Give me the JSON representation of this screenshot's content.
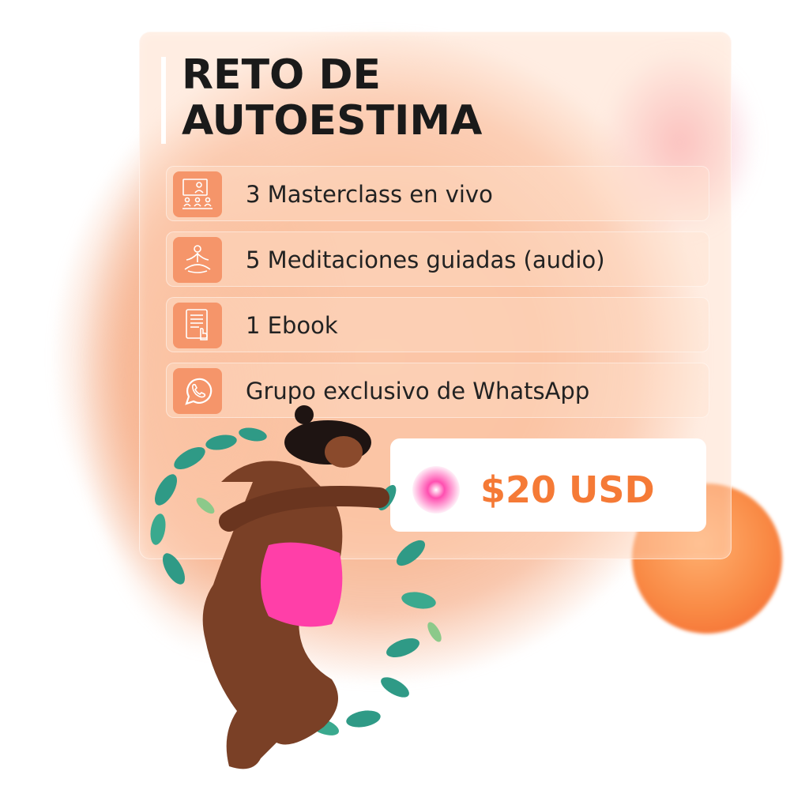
{
  "title": {
    "line1": "RETO DE",
    "line2": "AUTOESTIMA"
  },
  "features": [
    {
      "icon": "masterclass-presentation-icon",
      "label": "3 Masterclass en vivo"
    },
    {
      "icon": "meditation-icon",
      "label": "5 Meditaciones guiadas (audio)"
    },
    {
      "icon": "ebook-tablet-icon",
      "label": "1 Ebook"
    },
    {
      "icon": "whatsapp-icon",
      "label": "Grupo exclusivo de WhatsApp"
    }
  ],
  "price": "$20 USD",
  "colors": {
    "accent_orange": "#f57a36",
    "icon_bg": "#f5956a",
    "background_peach": "#f7b895",
    "figure_skin": "#7a4026",
    "figure_bikini_pink": "#ff3fa8",
    "leaves_green": "#2f9a86"
  },
  "illustration": "woman-hugging-herself-with-leaves"
}
